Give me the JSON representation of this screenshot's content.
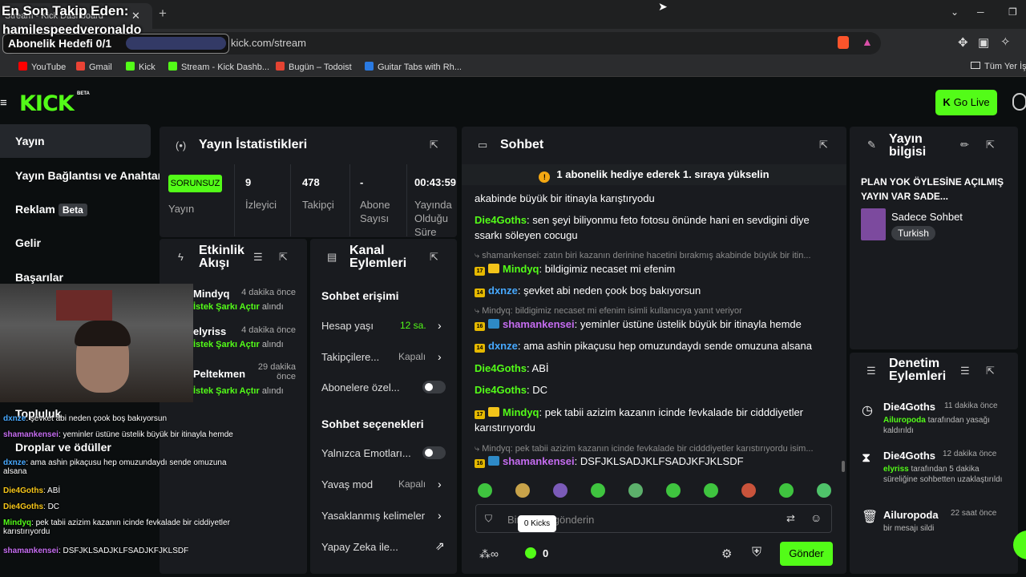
{
  "browser": {
    "tab_title": "Stream - Kick Dashboard",
    "url": "kick.com/stream",
    "bookmarks": [
      "YouTube",
      "Gmail",
      "Kick",
      "Stream - Kick Dashb...",
      "Bugün – Todoist",
      "Guitar Tabs with Rh..."
    ],
    "bookmark_colors": [
      "#ff0000",
      "#ea4335",
      "#53fc18",
      "#53fc18",
      "#e44332",
      "#2a7ae2"
    ],
    "all_bookmarks": "Tüm Yer İş"
  },
  "overlay": {
    "last_follower_label": "En Son Takip Eden:",
    "last_follower_name": "hamilespeedveronaldo",
    "sub_goal": "Abonelik Hedefi 0/1"
  },
  "header": {
    "logo": "KICK",
    "beta": "BETA",
    "go_live": "Go Live"
  },
  "sidebar": {
    "items": [
      {
        "label": "Yayın"
      },
      {
        "label": "Yayın Bağlantısı ve Anahtar"
      },
      {
        "label": "Reklam",
        "badge": "Beta"
      },
      {
        "label": "Gelir"
      },
      {
        "label": "Başarılar"
      },
      {
        "label": "Topluluk"
      },
      {
        "label": "Droplar ve ödüller"
      }
    ]
  },
  "stats": {
    "title": "Yayın İstatistikleri",
    "status": "SORUNSUZ",
    "status_label": "Yayın",
    "items": [
      {
        "value": "9",
        "label": "İzleyici"
      },
      {
        "value": "478",
        "label": "Takipçi"
      },
      {
        "value": "-",
        "label": "Abone Sayısı"
      },
      {
        "value": "00:43:59",
        "label": "Yayında Olduğu Süre"
      }
    ]
  },
  "activity": {
    "title": "Etkinlik Akışı",
    "items": [
      {
        "name": "Mindyq",
        "time": "4 dakika önce",
        "reward": "İstek Şarkı Açtır",
        "suffix": "alındı"
      },
      {
        "name": "elyriss",
        "time": "4 dakika önce",
        "reward": "İstek Şarkı Açtır",
        "suffix": "alındı"
      },
      {
        "name": "Peltekmen",
        "time": "29 dakika önce",
        "reward": "İstek Şarkı Açtır",
        "suffix": "alındı"
      }
    ]
  },
  "channel": {
    "title": "Kanal Eylemleri",
    "chat_access": "Sohbet erişimi",
    "account_age": "Hesap yaşı",
    "account_age_value": "12 sa.",
    "followers": "Takipçilere...",
    "followers_value": "Kapalı",
    "subscribers": "Abonelere özel...",
    "chat_options": "Sohbet seçenekleri",
    "emotes_only": "Yalnızca Emotları...",
    "slow_mode": "Yavaş mod",
    "slow_mode_value": "Kapalı",
    "banned_words": "Yasaklanmış kelimeler",
    "ai": "Yapay Zeka ile..."
  },
  "chat": {
    "title": "Sohbet",
    "pinned": "1 abonelik hediye ederek 1. sıraya yükselin",
    "messages": [
      {
        "type": "msg",
        "user": "",
        "text": "akabinde büyük bir itinayla karıştıryodu",
        "top_cut": true
      },
      {
        "type": "msg",
        "user": "Die4Goths",
        "color": "g",
        "text": "sen şeyi biliyonmu feto fotosu önünde hani en sevdigini diye ssarkı söleyen cocugu"
      },
      {
        "type": "reply",
        "text": "shamankensei: zatın biri kazanın derinine hacetini bırakmış akabinde büyük bir itin..."
      },
      {
        "type": "msg",
        "sub": "17",
        "gold": true,
        "user": "Mindyq",
        "color": "g",
        "text": "bildigimiz necaset mi efenim"
      },
      {
        "type": "msg",
        "sub": "14",
        "user": "dxnze",
        "color": "b",
        "text": "şevket abi neden çook boş bakıyorsun"
      },
      {
        "type": "reply",
        "text": "Mindyq: bildigimiz necaset mi efenim  isimli kullanıcıya yanıt veriyor"
      },
      {
        "type": "msg",
        "sub": "16",
        "blue": true,
        "user": "shamankensei",
        "color": "p",
        "text": "yeminler üstüne üstelik büyük bir itinayla hemde"
      },
      {
        "type": "msg",
        "sub": "14",
        "user": "dxnze",
        "color": "b",
        "text": "ama ashin pikaçusu hep omuzundaydı sende omuzuna alsana"
      },
      {
        "type": "msg",
        "user": "Die4Goths",
        "color": "g",
        "text": "ABİ"
      },
      {
        "type": "msg",
        "user": "Die4Goths",
        "color": "g",
        "text": "DC"
      },
      {
        "type": "msg",
        "sub": "17",
        "gold": true,
        "user": "Mindyq",
        "color": "g",
        "text": "pek tabii azizim kazanın icinde fevkalade bir cidddiyetler karıstırıyordu"
      },
      {
        "type": "reply",
        "text": "Mindyq: pek tabii azizim kazanın icinde fevkalade bir cidddiyetler karıstırıyordu  isim..."
      },
      {
        "type": "msg",
        "sub": "16",
        "blue": true,
        "user": "shamankensei",
        "color": "p",
        "text": "DSFJKLSADJKLFSADJKFJKLSDF"
      }
    ],
    "input_placeholder": "Bir mesaj gönderin",
    "kicks": "0 Kicks",
    "kick_count": "0",
    "send": "Gönder"
  },
  "info": {
    "title": "Yayın bilgisi",
    "stream_title": "PLAN YOK ÖYLESİNE AÇILMIŞ YAYIN VAR SADE...",
    "category": "Sadece Sohbet",
    "language": "Turkish"
  },
  "moderation": {
    "title": "Denetim Eylemleri",
    "items": [
      {
        "icon": "clock-icon",
        "name": "Die4Goths",
        "time": "11 dakika önce",
        "actor": "Ailuropoda",
        "desc": "tarafından yasağı kaldırıldı"
      },
      {
        "icon": "hourglass-icon",
        "name": "Die4Goths",
        "time": "12 dakika önce",
        "actor": "elyriss",
        "desc": "tarafından 5 dakika süreliğine sohbetten uzaklaştırıldı"
      },
      {
        "icon": "trash-icon",
        "name": "Ailuropoda",
        "time": "22 saat önce",
        "actor": "",
        "desc": "bir mesajı sildi"
      }
    ]
  },
  "overlay_chat": [
    {
      "user": "Mindyq",
      "text": "bildigimiz necaset mi efenim"
    },
    {
      "user": "dxnze",
      "text": "şevket abi neden çook boş bakıyorsun"
    },
    {
      "user": "shamankensei",
      "text": "yeminler üstüne üstelik büyük bir itinayla hemde"
    },
    {
      "user": "dxnze",
      "text": "ama ashin pikaçusu hep omuzundaydı sende omuzuna alsana"
    },
    {
      "user": "Die4Goths",
      "text": "ABİ"
    },
    {
      "user": "Die4Goths",
      "text": "DC"
    },
    {
      "user": "Mindyq",
      "text": "pek tabii azizim kazanın icinde fevkalade bir ciddiyetler karıstırıyordu"
    },
    {
      "user": "shamankensei",
      "text": "DSFJKLSADJKLFSADJKFJKLSDF"
    }
  ]
}
